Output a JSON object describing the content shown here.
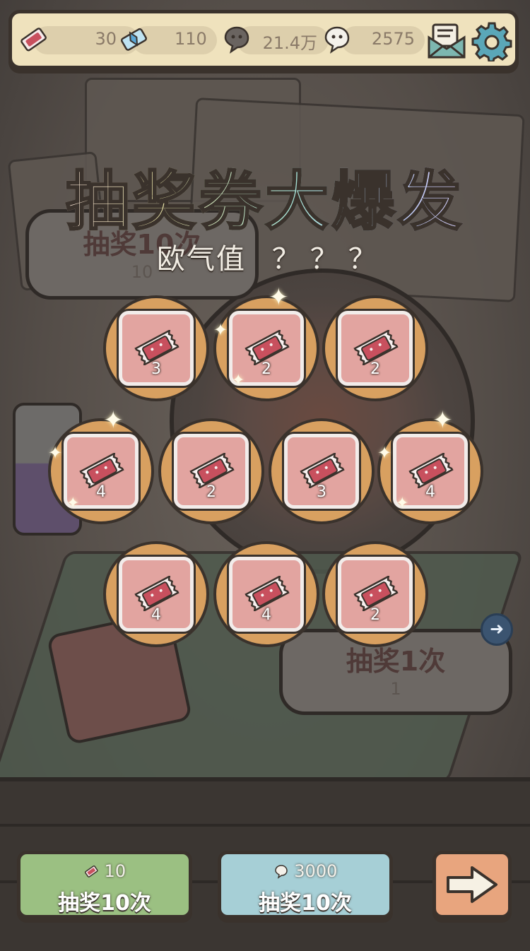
{
  "topbar": {
    "tickets": "30",
    "gems": "110",
    "dark_souls": "21.4万",
    "light_souls": "2575",
    "icons": [
      "ticket-icon",
      "gem-icon",
      "dark-soul-icon",
      "light-soul-icon",
      "mail-icon",
      "gear-icon"
    ]
  },
  "title": "抽奖券大爆发",
  "luck": {
    "label": "欧气值",
    "value": "？？？"
  },
  "background_buttons": {
    "draw10_label": "抽奖10次",
    "draw10_cost": "10",
    "draw1_label": "抽奖1次",
    "draw1_cost": "1"
  },
  "rewards": [
    {
      "count": "3",
      "sparkle": false
    },
    {
      "count": "2",
      "sparkle": true
    },
    {
      "count": "2",
      "sparkle": false
    },
    {
      "count": "4",
      "sparkle": true
    },
    {
      "count": "2",
      "sparkle": false
    },
    {
      "count": "3",
      "sparkle": false
    },
    {
      "count": "4",
      "sparkle": true
    },
    {
      "count": "4",
      "sparkle": false
    },
    {
      "count": "4",
      "sparkle": false
    },
    {
      "count": "2",
      "sparkle": false
    }
  ],
  "bottom": {
    "ticket_draw": {
      "cost": "10",
      "label": "抽奖10次",
      "color": "#9bc082"
    },
    "soul_draw": {
      "cost": "3000",
      "label": "抽奖10次",
      "color": "#a6cfd6"
    },
    "next": {
      "icon": "arrow-right-icon",
      "color": "#e8a57e"
    }
  },
  "colors": {
    "card_ring": "#d8a060",
    "card_inner": "#e2a4a0",
    "ticket": "#c8505e"
  }
}
